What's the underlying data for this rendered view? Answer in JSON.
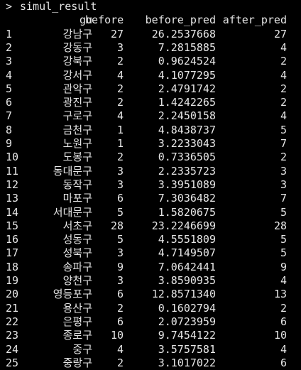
{
  "console": {
    "prompt_symbol": ">",
    "command": "simul_result",
    "header": {
      "gu": "gu",
      "before": "before",
      "before_pred": "before_pred",
      "after_pred": "after_pred"
    },
    "rows": [
      {
        "idx": "1",
        "gu": "강남구",
        "before": "27",
        "before_pred": "26.2537668",
        "after_pred": "27"
      },
      {
        "idx": "2",
        "gu": "강동구",
        "before": "3",
        "before_pred": "7.2815885",
        "after_pred": "4"
      },
      {
        "idx": "3",
        "gu": "강북구",
        "before": "2",
        "before_pred": "0.9624524",
        "after_pred": "2"
      },
      {
        "idx": "4",
        "gu": "강서구",
        "before": "4",
        "before_pred": "4.1077295",
        "after_pred": "4"
      },
      {
        "idx": "5",
        "gu": "관악구",
        "before": "2",
        "before_pred": "2.4791742",
        "after_pred": "2"
      },
      {
        "idx": "6",
        "gu": "광진구",
        "before": "2",
        "before_pred": "1.4242265",
        "after_pred": "2"
      },
      {
        "idx": "7",
        "gu": "구로구",
        "before": "4",
        "before_pred": "2.2450158",
        "after_pred": "4"
      },
      {
        "idx": "8",
        "gu": "금천구",
        "before": "1",
        "before_pred": "4.8438737",
        "after_pred": "5"
      },
      {
        "idx": "9",
        "gu": "노원구",
        "before": "1",
        "before_pred": "3.2233043",
        "after_pred": "7"
      },
      {
        "idx": "10",
        "gu": "도봉구",
        "before": "2",
        "before_pred": "0.7336505",
        "after_pred": "2"
      },
      {
        "idx": "11",
        "gu": "동대문구",
        "before": "3",
        "before_pred": "2.2335723",
        "after_pred": "3"
      },
      {
        "idx": "12",
        "gu": "동작구",
        "before": "3",
        "before_pred": "3.3951089",
        "after_pred": "3"
      },
      {
        "idx": "13",
        "gu": "마포구",
        "before": "6",
        "before_pred": "7.3036482",
        "after_pred": "7"
      },
      {
        "idx": "14",
        "gu": "서대문구",
        "before": "5",
        "before_pred": "1.5820675",
        "after_pred": "5"
      },
      {
        "idx": "15",
        "gu": "서초구",
        "before": "28",
        "before_pred": "23.2246699",
        "after_pred": "28"
      },
      {
        "idx": "16",
        "gu": "성동구",
        "before": "5",
        "before_pred": "4.5551809",
        "after_pred": "5"
      },
      {
        "idx": "17",
        "gu": "성북구",
        "before": "3",
        "before_pred": "4.7149507",
        "after_pred": "5"
      },
      {
        "idx": "18",
        "gu": "송파구",
        "before": "9",
        "before_pred": "7.0642441",
        "after_pred": "9"
      },
      {
        "idx": "19",
        "gu": "양천구",
        "before": "3",
        "before_pred": "3.8590935",
        "after_pred": "4"
      },
      {
        "idx": "20",
        "gu": "영등포구",
        "before": "6",
        "before_pred": "12.8571340",
        "after_pred": "13"
      },
      {
        "idx": "21",
        "gu": "용산구",
        "before": "2",
        "before_pred": "0.1602794",
        "after_pred": "2"
      },
      {
        "idx": "22",
        "gu": "은평구",
        "before": "6",
        "before_pred": "2.0723959",
        "after_pred": "6"
      },
      {
        "idx": "23",
        "gu": "종로구",
        "before": "10",
        "before_pred": "9.7454122",
        "after_pred": "10"
      },
      {
        "idx": "24",
        "gu": "중구",
        "before": "4",
        "before_pred": "3.5757581",
        "after_pred": "4"
      },
      {
        "idx": "25",
        "gu": "중랑구",
        "before": "2",
        "before_pred": "3.1017022",
        "after_pred": "6"
      }
    ]
  }
}
